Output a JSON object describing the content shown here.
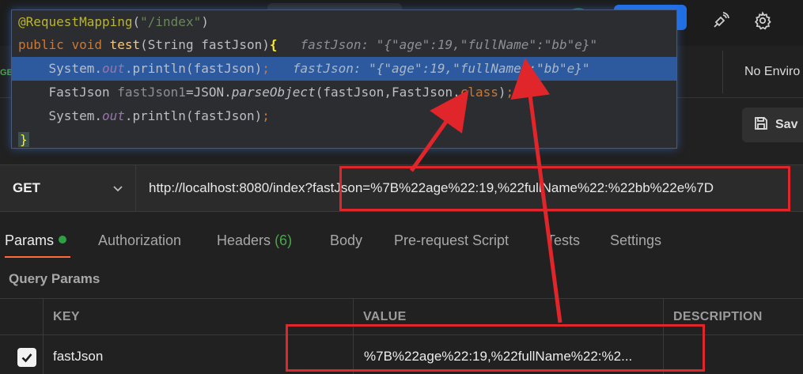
{
  "code_popup": {
    "line1": {
      "annotation": "@RequestMapping",
      "paren_open": "(",
      "string": "\"/index\"",
      "paren_close": ")"
    },
    "line2": {
      "kw_public": "public",
      "kw_void": "void",
      "method": "test",
      "params": "(String fastJson)",
      "brace": "{",
      "hint": "fastJson: \"{\"age\":19,\"fullName\":\"bb\"e}\""
    },
    "line3": {
      "prefix": "System.",
      "field": "out",
      "call": ".println(fastJson)",
      "semi": ";",
      "hint": "fastJson: \"{\"age\":19,\"fullName\":\"bb\"e}\""
    },
    "line4": {
      "type": "FastJson ",
      "var": "fastJson1",
      "eq": "=JSON.",
      "method": "parseObject",
      "args": "(fastJson,FastJson.",
      "kw_class": "class",
      "close": ")",
      "semi": ";"
    },
    "line5": {
      "prefix": "System.",
      "field": "out",
      "call": ".println(fastJson)",
      "semi": ";"
    },
    "line6": {
      "brace": "}"
    }
  },
  "tabrow": {
    "side_text": "GE"
  },
  "environment": {
    "label": "No Enviro"
  },
  "save_button": {
    "label": "Sav"
  },
  "request": {
    "method": "GET",
    "url": "http://localhost:8080/index?fastJson=%7B%22age%22:19,%22fullName%22:%22bb%22e%7D"
  },
  "tabs": {
    "params": "Params",
    "authorization": "Authorization",
    "headers": "Headers",
    "headers_count": "(6)",
    "body": "Body",
    "prerequest": "Pre-request Script",
    "tests": "Tests",
    "settings": "Settings"
  },
  "query_params": {
    "title": "Query Params",
    "columns": {
      "key": "KEY",
      "value": "VALUE",
      "description": "DESCRIPTION"
    },
    "rows": [
      {
        "checked": true,
        "key": "fastJson",
        "value": "%7B%22age%22:19,%22fullName%22:%2..."
      }
    ]
  },
  "colors": {
    "accent": "#ff6c37",
    "highlight": "#e0252b",
    "active_dot": "#2ea043"
  }
}
